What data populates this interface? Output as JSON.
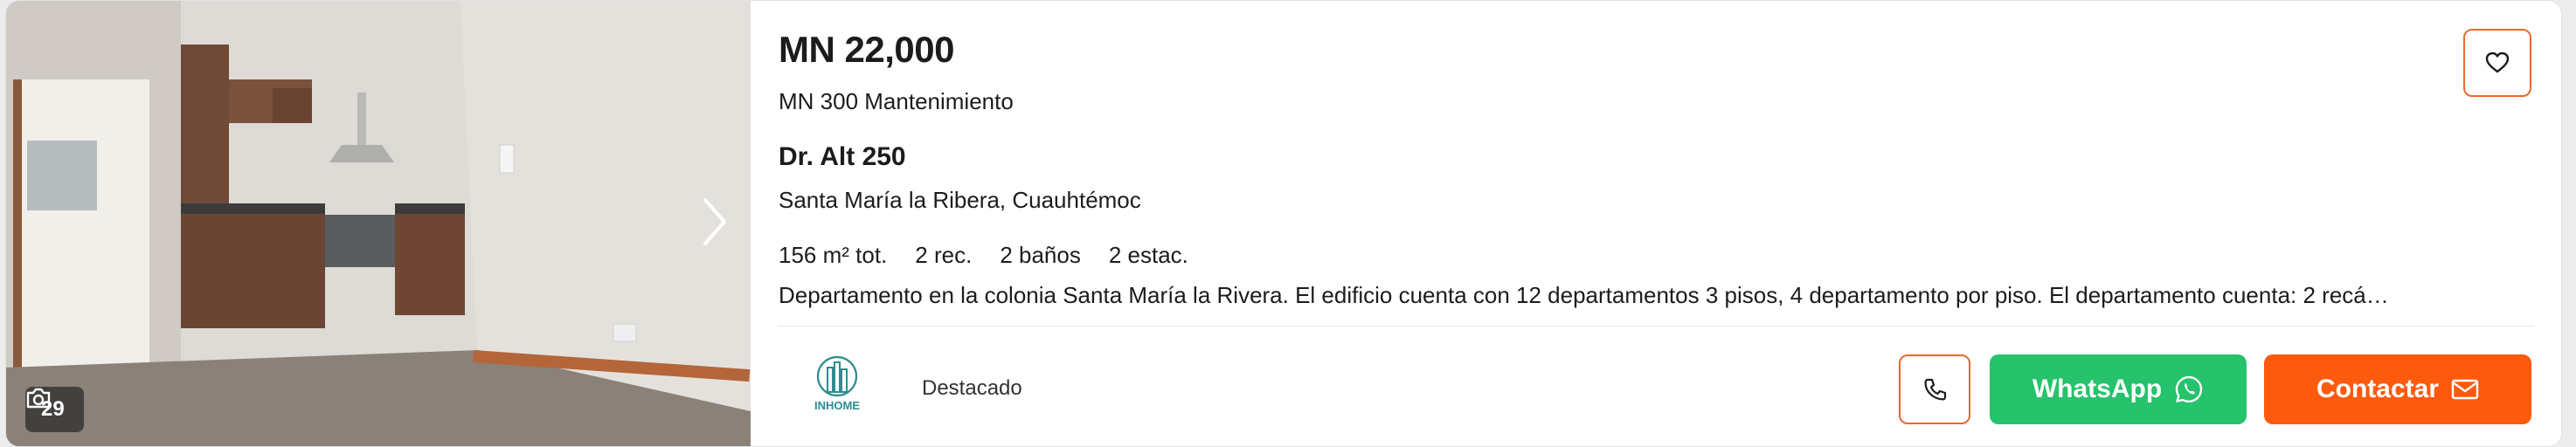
{
  "listing": {
    "price": "MN 22,000",
    "maintenance": "MN 300 Mantenimiento",
    "street": "Dr. Alt 250",
    "neighborhood": "Santa María la Ribera, Cuauhtémoc",
    "features": {
      "area": "156 m² tot.",
      "bedrooms": "2 rec.",
      "bathrooms": "2 baños",
      "parking": "2 estac."
    },
    "description": "Departamento en la colonia Santa María la Rivera. El edificio cuenta con 12 departamentos 3 pisos, 4 departamento por piso. El departamento cuenta: 2 recá…",
    "photo_count": "29",
    "featured_label": "Destacado"
  },
  "agency": {
    "logo_text": "INHOME"
  },
  "actions": {
    "whatsapp_label": "WhatsApp",
    "contact_label": "Contactar"
  },
  "colors": {
    "accent": "#fe5a0d",
    "accent_border": "#e86a2e",
    "whatsapp": "#25c36b",
    "logo": "#2e8c91"
  },
  "icons": [
    "chevron-right-icon",
    "camera-icon",
    "heart-icon",
    "phone-icon",
    "whatsapp-icon",
    "mail-icon",
    "building-logo-icon"
  ]
}
